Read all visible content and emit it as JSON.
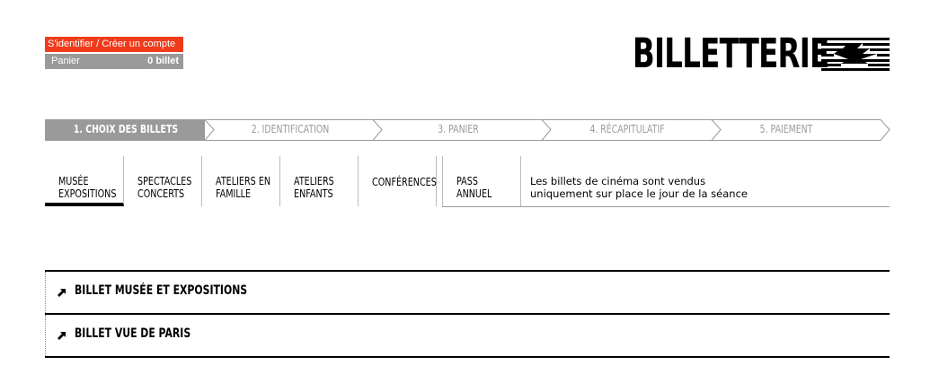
{
  "account": {
    "login_label": "S'identifier",
    "separator": " / ",
    "create_label": "Créer un compte",
    "cart_label": "Panier",
    "cart_count": "0 billet"
  },
  "brand": {
    "title": "BILLETTERIE",
    "logo_icon": "striped-logo-icon"
  },
  "steps": [
    {
      "label": "1. CHOIX DES BILLETS",
      "active": true
    },
    {
      "label": "2. IDENTIFICATION",
      "active": false
    },
    {
      "label": "3. PANIER",
      "active": false
    },
    {
      "label": "4. RÉCAPITULATIF",
      "active": false
    },
    {
      "label": "5. PAIEMENT",
      "active": false
    }
  ],
  "tabs": [
    {
      "line1": "MUSÉE",
      "line2": "EXPOSITIONS",
      "active": true
    },
    {
      "line1": "SPECTACLES",
      "line2": "CONCERTS",
      "active": false
    },
    {
      "line1": "ATELIERS EN",
      "line2": "FAMILLE",
      "active": false
    },
    {
      "line1": "ATELIERS",
      "line2": "ENFANTS",
      "active": false
    },
    {
      "line1": "CONFÉRENCES",
      "line2": "",
      "active": false
    },
    {
      "line1": "PASS",
      "line2": "ANNUEL",
      "active": false
    }
  ],
  "notice": "Les billets de cinéma sont vendus\nuniquement sur place le jour de la séance",
  "tickets": [
    {
      "title": "BILLET MUSÉE ET EXPOSITIONS"
    },
    {
      "title": "BILLET VUE DE PARIS"
    }
  ],
  "colors": {
    "accent": "#ef3b1a",
    "cart_bg": "#9a9a9a",
    "active_step": "#9a9a9a"
  }
}
